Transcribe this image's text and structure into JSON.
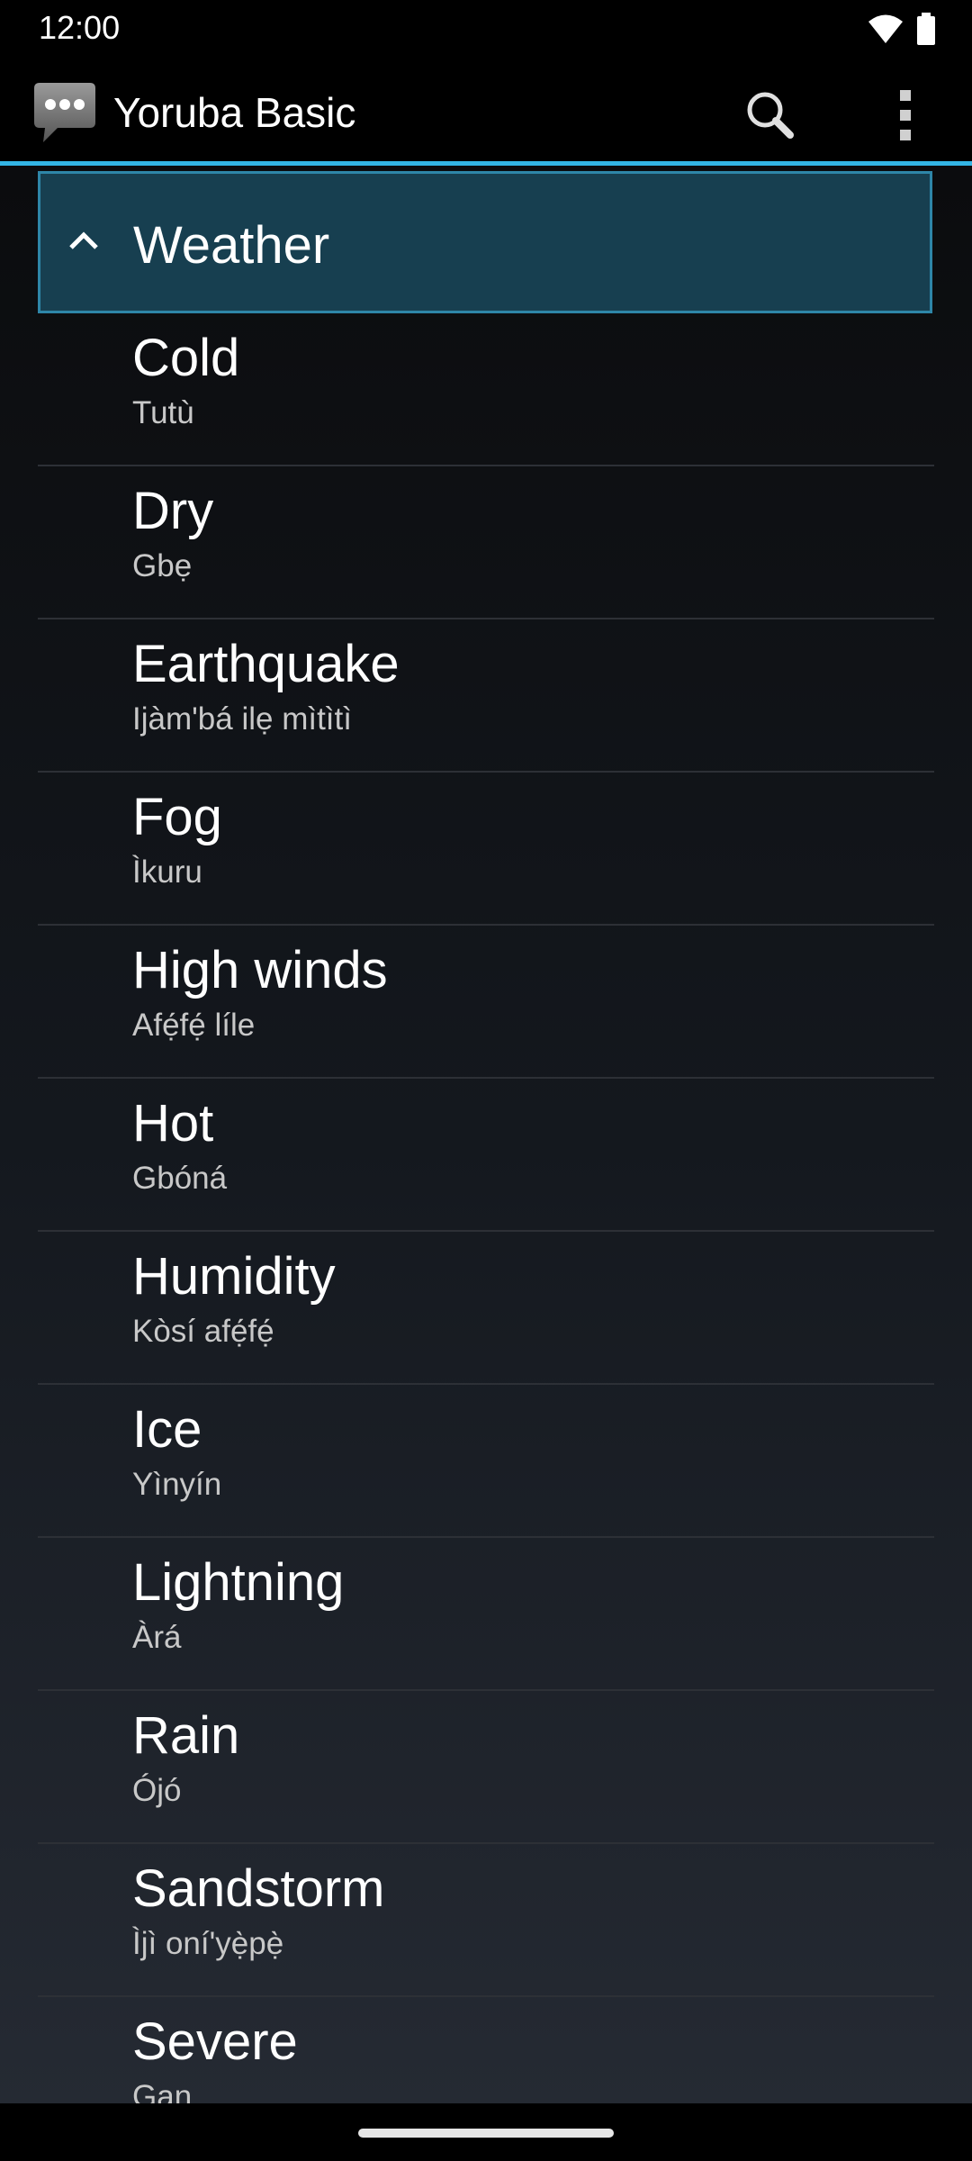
{
  "status_bar": {
    "time": "12:00"
  },
  "action_bar": {
    "title": "Yoruba Basic"
  },
  "group": {
    "title": "Weather"
  },
  "items": [
    {
      "en": "Cold",
      "yo": "Tutù"
    },
    {
      "en": "Dry",
      "yo": "Gbẹ"
    },
    {
      "en": "Earthquake",
      "yo": "Ijàm'bá ilẹ mìtìtì"
    },
    {
      "en": "Fog",
      "yo": "Ìkuru"
    },
    {
      "en": "High winds",
      "yo": "Afẹ́fẹ́ líle"
    },
    {
      "en": "Hot",
      "yo": "Gbóná"
    },
    {
      "en": "Humidity",
      "yo": "Kòsí afẹ́fẹ́"
    },
    {
      "en": "Ice",
      "yo": "Yìnyín"
    },
    {
      "en": "Lightning",
      "yo": "Àrá"
    },
    {
      "en": "Rain",
      "yo": "Ójó"
    },
    {
      "en": "Sandstorm",
      "yo": "Ìjì oní'yẹ̀pẹ̀"
    },
    {
      "en": "Severe",
      "yo": "Gan"
    }
  ],
  "colors": {
    "accent": "#33b5e5",
    "group_header_bg": "#173f50",
    "group_header_border": "#2e86a8"
  },
  "icons": {
    "app": "speech-bubble-icon",
    "search": "search-icon",
    "overflow": "more-vert-icon",
    "group": "chevron-up-icon",
    "wifi": "wifi-icon",
    "battery": "battery-icon"
  }
}
